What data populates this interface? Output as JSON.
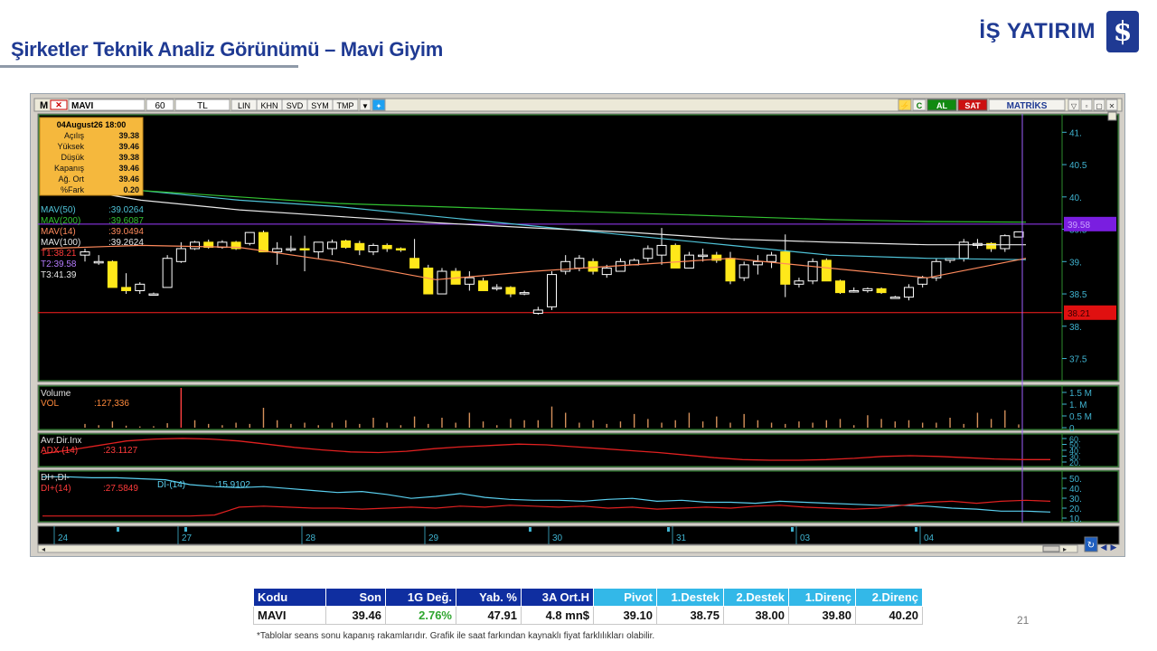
{
  "slide": {
    "title": "Şirketler Teknik Analiz Görünümü – Mavi Giyim",
    "brand": "İŞ YATIRIM",
    "page_number": "21",
    "footnote": "*Tablolar seans sonu kapanış rakamlarıdır. Grafik ile saat farkından kaynaklı fiyat farklılıkları olabilir."
  },
  "toolbar": {
    "symbol": "MAVI",
    "period": "60",
    "currency": "TL",
    "buttons": [
      "LIN",
      "KHN",
      "SVD",
      "SYM",
      "TMP"
    ],
    "al": "AL",
    "sat": "SAT",
    "brand": "MATRİKS",
    "accent_green": "#118a11",
    "accent_red": "#cc1010"
  },
  "info_box": {
    "header": "04August26 18:00",
    "rows": [
      {
        "label": "Açılış",
        "value": "39.38"
      },
      {
        "label": "Yüksek",
        "value": "39.46"
      },
      {
        "label": "Düşük",
        "value": "39.38"
      },
      {
        "label": "Kapanış",
        "value": "39.46"
      },
      {
        "label": "Ağ. Ort",
        "value": "39.46"
      },
      {
        "label": "%Fark",
        "value": "0.20"
      }
    ]
  },
  "ma_labels": [
    {
      "name": "MAV(50)",
      "value": ":39.0264",
      "color": "#4fc3d8"
    },
    {
      "name": "MAV(200)",
      "value": ":39.6087",
      "color": "#32c232"
    },
    {
      "name": "MAV(14)",
      "value": ":39.0494",
      "color": "#ff8a5c"
    },
    {
      "name": "MAV(100)",
      "value": ":39.2624",
      "color": "#e8e8e8"
    },
    {
      "name": "T1:38.21",
      "value": "",
      "color": "#ff3b3b"
    },
    {
      "name": "T2:39.58",
      "value": "",
      "color": "#b67cff"
    },
    {
      "name": "T3:41.39",
      "value": "",
      "color": "#e8e8e8"
    }
  ],
  "price_tags": [
    {
      "text": "39.58",
      "value": 39.58,
      "color": "#7a1ee0"
    },
    {
      "text": "38.21",
      "value": 38.21,
      "color": "#e01010"
    }
  ],
  "volume_panel": {
    "title": "Volume",
    "label": "VOL",
    "value": ":127,336",
    "ticks": [
      "1.5 M",
      "1. M",
      "0.5 M",
      "0"
    ]
  },
  "adx_panel": {
    "title": "Avr.Dir.Inx",
    "label": "ADX (14)",
    "value": ":23.1127",
    "ticks": [
      "60.",
      "50.",
      "40.",
      "30.",
      "20."
    ]
  },
  "di_panel": {
    "title": "DI+,DI-",
    "label": "DI+(14)",
    "value": ":27.5849",
    "label2": "DI-(14)",
    "value2": ":15.9102",
    "ticks": [
      "50.",
      "40.",
      "30.",
      "20.",
      "10."
    ]
  },
  "x_labels": [
    "24",
    "27",
    "28",
    "29",
    "30",
    "31",
    "03",
    "04"
  ],
  "chart_data": {
    "type": "candlestick",
    "ylim": [
      37.2,
      41.2
    ],
    "yticks": [
      "41.",
      "40.5",
      "40.",
      "39.5",
      "39.",
      "38.5",
      "38.",
      "37.5"
    ],
    "candles": [
      {
        "o": 39.1,
        "h": 39.2,
        "l": 39.0,
        "c": 39.15
      },
      {
        "o": 39.0,
        "h": 39.1,
        "l": 38.95,
        "c": 39.0
      },
      {
        "o": 39.0,
        "h": 39.02,
        "l": 38.6,
        "c": 38.6
      },
      {
        "o": 38.6,
        "h": 38.82,
        "l": 38.5,
        "c": 38.55
      },
      {
        "o": 38.55,
        "h": 38.68,
        "l": 38.5,
        "c": 38.65
      },
      {
        "o": 38.5,
        "h": 38.52,
        "l": 38.48,
        "c": 38.5
      },
      {
        "o": 38.6,
        "h": 39.1,
        "l": 38.6,
        "c": 39.05
      },
      {
        "o": 39.0,
        "h": 39.3,
        "l": 38.98,
        "c": 39.2
      },
      {
        "o": 39.2,
        "h": 39.32,
        "l": 39.18,
        "c": 39.3
      },
      {
        "o": 39.3,
        "h": 39.34,
        "l": 39.2,
        "c": 39.22
      },
      {
        "o": 39.22,
        "h": 39.33,
        "l": 39.2,
        "c": 39.3
      },
      {
        "o": 39.3,
        "h": 39.32,
        "l": 39.18,
        "c": 39.2
      },
      {
        "o": 39.28,
        "h": 39.45,
        "l": 39.25,
        "c": 39.45
      },
      {
        "o": 39.45,
        "h": 39.48,
        "l": 39.15,
        "c": 39.15
      },
      {
        "o": 39.15,
        "h": 39.3,
        "l": 38.95,
        "c": 39.2
      },
      {
        "o": 39.18,
        "h": 39.4,
        "l": 39.15,
        "c": 39.2
      },
      {
        "o": 39.2,
        "h": 39.4,
        "l": 38.85,
        "c": 39.18
      },
      {
        "o": 39.15,
        "h": 39.3,
        "l": 39.05,
        "c": 39.3
      },
      {
        "o": 39.2,
        "h": 39.34,
        "l": 39.1,
        "c": 39.3
      },
      {
        "o": 39.32,
        "h": 39.34,
        "l": 39.2,
        "c": 39.22
      },
      {
        "o": 39.28,
        "h": 39.32,
        "l": 39.1,
        "c": 39.18
      },
      {
        "o": 39.15,
        "h": 39.28,
        "l": 39.1,
        "c": 39.25
      },
      {
        "o": 39.25,
        "h": 39.28,
        "l": 39.15,
        "c": 39.2
      },
      {
        "o": 39.2,
        "h": 39.22,
        "l": 39.15,
        "c": 39.18
      },
      {
        "o": 39.05,
        "h": 39.35,
        "l": 38.9,
        "c": 38.9
      },
      {
        "o": 38.9,
        "h": 38.95,
        "l": 38.5,
        "c": 38.5
      },
      {
        "o": 38.5,
        "h": 38.9,
        "l": 38.5,
        "c": 38.85
      },
      {
        "o": 38.85,
        "h": 38.9,
        "l": 38.65,
        "c": 38.65
      },
      {
        "o": 38.65,
        "h": 38.85,
        "l": 38.55,
        "c": 38.75
      },
      {
        "o": 38.7,
        "h": 38.75,
        "l": 38.55,
        "c": 38.55
      },
      {
        "o": 38.6,
        "h": 38.65,
        "l": 38.55,
        "c": 38.6
      },
      {
        "o": 38.6,
        "h": 38.62,
        "l": 38.45,
        "c": 38.5
      },
      {
        "o": 38.5,
        "h": 38.55,
        "l": 38.48,
        "c": 38.52
      },
      {
        "o": 38.2,
        "h": 38.3,
        "l": 38.18,
        "c": 38.25
      },
      {
        "o": 38.3,
        "h": 38.85,
        "l": 38.25,
        "c": 38.8
      },
      {
        "o": 38.85,
        "h": 39.1,
        "l": 38.8,
        "c": 39.0
      },
      {
        "o": 38.9,
        "h": 39.1,
        "l": 38.85,
        "c": 39.05
      },
      {
        "o": 39.0,
        "h": 39.05,
        "l": 38.8,
        "c": 38.85
      },
      {
        "o": 38.8,
        "h": 38.95,
        "l": 38.75,
        "c": 38.9
      },
      {
        "o": 38.85,
        "h": 39.05,
        "l": 38.85,
        "c": 39.0
      },
      {
        "o": 38.95,
        "h": 39.05,
        "l": 38.95,
        "c": 39.02
      },
      {
        "o": 39.05,
        "h": 39.25,
        "l": 39.0,
        "c": 39.2
      },
      {
        "o": 39.1,
        "h": 39.52,
        "l": 38.95,
        "c": 39.25
      },
      {
        "o": 39.25,
        "h": 39.28,
        "l": 38.9,
        "c": 38.9
      },
      {
        "o": 38.9,
        "h": 39.15,
        "l": 38.9,
        "c": 39.1
      },
      {
        "o": 39.1,
        "h": 39.2,
        "l": 39.0,
        "c": 39.1
      },
      {
        "o": 39.1,
        "h": 39.15,
        "l": 38.98,
        "c": 39.02
      },
      {
        "o": 39.05,
        "h": 39.15,
        "l": 38.65,
        "c": 38.7
      },
      {
        "o": 38.75,
        "h": 39.0,
        "l": 38.7,
        "c": 38.95
      },
      {
        "o": 38.95,
        "h": 39.1,
        "l": 38.8,
        "c": 39.0
      },
      {
        "o": 39.0,
        "h": 39.15,
        "l": 38.9,
        "c": 39.1
      },
      {
        "o": 39.15,
        "h": 39.42,
        "l": 38.45,
        "c": 38.65
      },
      {
        "o": 38.65,
        "h": 38.75,
        "l": 38.6,
        "c": 38.7
      },
      {
        "o": 38.7,
        "h": 39.05,
        "l": 38.65,
        "c": 39.0
      },
      {
        "o": 39.02,
        "h": 39.05,
        "l": 38.7,
        "c": 38.7
      },
      {
        "o": 38.7,
        "h": 38.72,
        "l": 38.5,
        "c": 38.52
      },
      {
        "o": 38.55,
        "h": 38.6,
        "l": 38.52,
        "c": 38.55
      },
      {
        "o": 38.55,
        "h": 38.6,
        "l": 38.52,
        "c": 38.58
      },
      {
        "o": 38.58,
        "h": 38.6,
        "l": 38.5,
        "c": 38.52
      },
      {
        "o": 38.45,
        "h": 38.47,
        "l": 38.43,
        "c": 38.45
      },
      {
        "o": 38.45,
        "h": 38.65,
        "l": 38.4,
        "c": 38.6
      },
      {
        "o": 38.65,
        "h": 38.78,
        "l": 38.6,
        "c": 38.75
      },
      {
        "o": 38.75,
        "h": 39.05,
        "l": 38.7,
        "c": 39.0
      },
      {
        "o": 39.02,
        "h": 39.05,
        "l": 38.98,
        "c": 39.05
      },
      {
        "o": 39.05,
        "h": 39.35,
        "l": 39.0,
        "c": 39.3
      },
      {
        "o": 39.25,
        "h": 39.35,
        "l": 39.2,
        "c": 39.28
      },
      {
        "o": 39.28,
        "h": 39.3,
        "l": 39.15,
        "c": 39.2
      },
      {
        "o": 39.2,
        "h": 39.42,
        "l": 39.15,
        "c": 39.4
      },
      {
        "o": 39.38,
        "h": 39.46,
        "l": 39.38,
        "c": 39.46
      }
    ],
    "ma": [
      {
        "name": "MAV(50)",
        "color": "#4fc3d8",
        "values": [
          40.3,
          40.1,
          39.95,
          39.85,
          39.7,
          39.55,
          39.4,
          39.25,
          39.1,
          39.05,
          39.03
        ]
      },
      {
        "name": "MAV(200)",
        "color": "#32c232",
        "values": [
          40.25,
          40.1,
          40.0,
          39.9,
          39.85,
          39.8,
          39.75,
          39.7,
          39.65,
          39.62,
          39.61
        ]
      },
      {
        "name": "MAV(14)",
        "color": "#ff8a5c",
        "values": [
          39.2,
          39.25,
          39.22,
          39.0,
          38.72,
          38.85,
          38.95,
          39.05,
          38.9,
          38.75,
          39.05
        ]
      },
      {
        "name": "MAV(100)",
        "color": "#e8e8e8",
        "values": [
          40.2,
          39.95,
          39.8,
          39.7,
          39.6,
          39.52,
          39.45,
          39.35,
          39.3,
          39.26,
          39.26
        ]
      }
    ],
    "volume": [
      0.15,
      0.1,
      0.25,
      0.08,
      0.05,
      0.06,
      0.18,
      1.6,
      0.3,
      0.15,
      0.1,
      0.2,
      0.15,
      0.8,
      0.3,
      0.15,
      0.2,
      0.1,
      0.2,
      0.3,
      0.15,
      0.4,
      0.2,
      0.1,
      0.45,
      0.15,
      0.4,
      0.2,
      0.6,
      0.25,
      0.1,
      0.35,
      0.3,
      0.3,
      0.85,
      0.6,
      0.2,
      0.3,
      0.15,
      0.25,
      0.55,
      0.35,
      0.2,
      0.3,
      0.6,
      0.25,
      0.45,
      0.2,
      0.55,
      0.3,
      0.2,
      0.15,
      0.25,
      0.2,
      0.3,
      0.35,
      0.1,
      0.5,
      0.35,
      0.25,
      0.3,
      0.2,
      0.2,
      0.4,
      0.15,
      0.6,
      0.35,
      0.7,
      0.13
    ],
    "adx": [
      32,
      38,
      45,
      52,
      55,
      56,
      55,
      52,
      47,
      42,
      38,
      35,
      34,
      36,
      40,
      43,
      45,
      47,
      46,
      43,
      40,
      37,
      34,
      30,
      26,
      23,
      22,
      22,
      23,
      25,
      28,
      29,
      28,
      26,
      24,
      23,
      23
    ],
    "di_plus": [
      12,
      12,
      12,
      12,
      12,
      12,
      12,
      13,
      21,
      22,
      21,
      20,
      20,
      19,
      20,
      21,
      20,
      22,
      21,
      23,
      22,
      21,
      22,
      20,
      21,
      19,
      20,
      21,
      20,
      22,
      23,
      21,
      20,
      19,
      20,
      23,
      26,
      27,
      25,
      27,
      28,
      27
    ],
    "di_minus": [
      52,
      52,
      51,
      51,
      50,
      49,
      44,
      42,
      41,
      42,
      40,
      38,
      36,
      37,
      34,
      30,
      32,
      35,
      31,
      29,
      28,
      28,
      27,
      29,
      30,
      27,
      28,
      26,
      26,
      25,
      27,
      26,
      25,
      24,
      23,
      23,
      22,
      20,
      19,
      17,
      17,
      16
    ]
  },
  "table": {
    "headers_navy": [
      "Kodu",
      "Son",
      "1G Değ.",
      "Yab. %",
      "3A Ort.H"
    ],
    "headers_cyan": [
      "Pivot",
      "1.Destek",
      "2.Destek",
      "1.Direnç",
      "2.Direnç"
    ],
    "row": [
      "MAVI",
      "39.46",
      "2.76%",
      "47.91",
      "4.8 mn$",
      "39.10",
      "38.75",
      "38.00",
      "39.80",
      "40.20"
    ],
    "positive_color": "#2ea52e"
  }
}
